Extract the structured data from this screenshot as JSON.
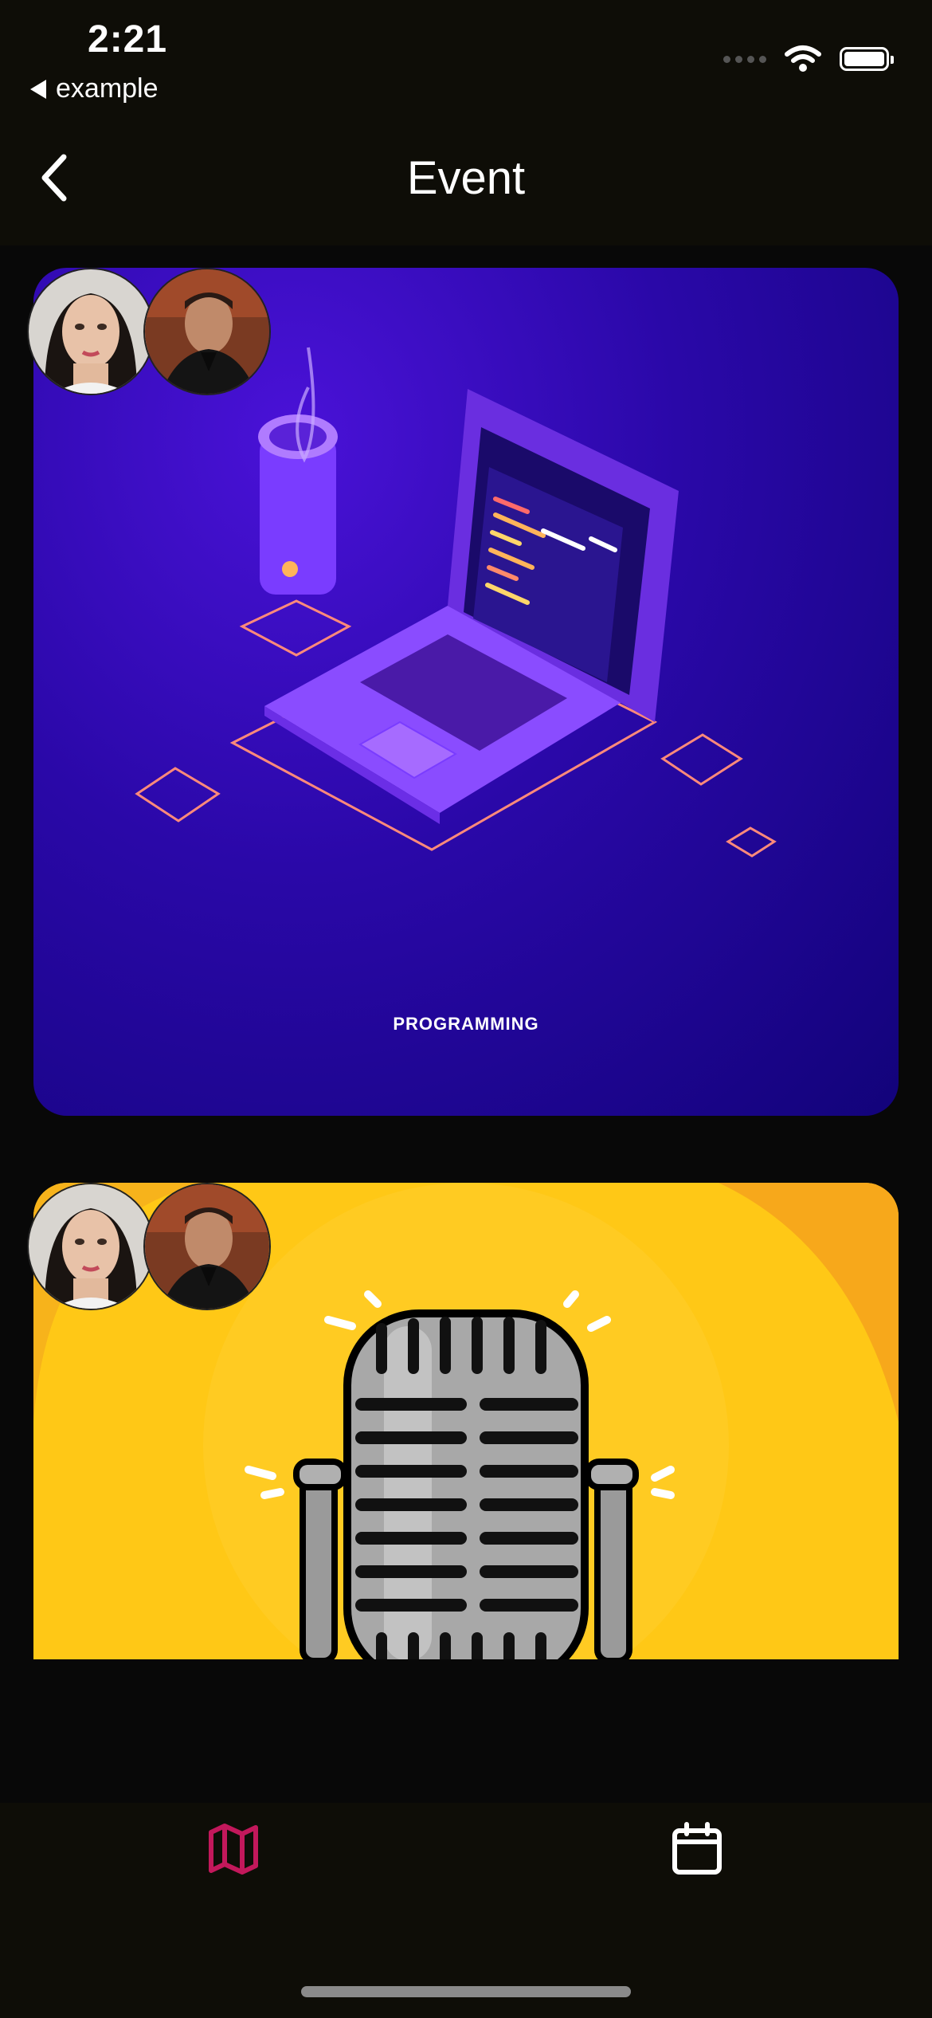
{
  "status_bar": {
    "time": "2:21",
    "back_app": "example"
  },
  "header": {
    "title": "Event"
  },
  "events": [
    {
      "image": "programming-laptop-illustration",
      "caption": "PROGRAMMING"
    },
    {
      "image": "microphone-illustration",
      "caption": ""
    }
  ],
  "tab_bar": {
    "items": [
      {
        "icon": "map-icon",
        "active": true,
        "color": "#c2185b"
      },
      {
        "icon": "calendar-icon",
        "active": false,
        "color": "#ffffff"
      }
    ]
  }
}
